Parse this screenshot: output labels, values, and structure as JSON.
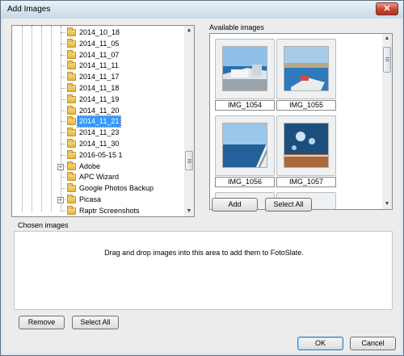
{
  "window": {
    "title": "Add Images",
    "close_symbol": "✕"
  },
  "tree": {
    "items": [
      {
        "label": "2014_10_18"
      },
      {
        "label": "2014_11_05"
      },
      {
        "label": "2014_11_07"
      },
      {
        "label": "2014_11_11"
      },
      {
        "label": "2014_11_17"
      },
      {
        "label": "2014_11_18"
      },
      {
        "label": "2014_11_19"
      },
      {
        "label": "2014_11_20"
      },
      {
        "label": "2014_11_21",
        "selected": true
      },
      {
        "label": "2014_11_23"
      },
      {
        "label": "2014_11_30"
      },
      {
        "label": "2016-05-15 1"
      },
      {
        "label": "Adobe",
        "expandable": true
      },
      {
        "label": "APC Wizard"
      },
      {
        "label": "Google Photos Backup"
      },
      {
        "label": "Picasa",
        "expandable": true
      },
      {
        "label": "Raptr Screenshots"
      }
    ]
  },
  "available": {
    "label": "Available images",
    "images": [
      {
        "name": "IMG_1054"
      },
      {
        "name": "IMG_1055"
      },
      {
        "name": "IMG_1056"
      },
      {
        "name": "IMG_1057"
      }
    ],
    "add_label": "Add",
    "select_all_label": "Select All"
  },
  "chosen": {
    "label": "Chosen images",
    "hint": "Drag and drop images into this area to add them to FotoSlate.",
    "remove_label": "Remove",
    "select_all_label": "Select All"
  },
  "footer": {
    "ok_label": "OK",
    "cancel_label": "Cancel"
  }
}
